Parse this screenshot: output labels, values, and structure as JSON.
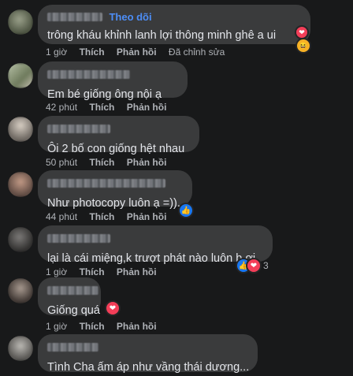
{
  "comments": [
    {
      "follow": "Theo dõi",
      "text": "trông kháu khỉnh lanh lợi thông minh ghê a ui",
      "time": "1 giờ",
      "like": "Thích",
      "reply": "Phản hồi",
      "edited": "Đã chỉnh sửa"
    },
    {
      "text": "Em bé giống ông nội ạ",
      "time": "42 phút",
      "like": "Thích",
      "reply": "Phản hồi"
    },
    {
      "text": "Ôi 2 bố con giống hệt nhau",
      "time": "50 phút",
      "like": "Thích",
      "reply": "Phản hồi"
    },
    {
      "text": "Như photocopy luôn ạ =)).",
      "time": "44 phút",
      "like": "Thích",
      "reply": "Phản hồi"
    },
    {
      "text": "lại là cái miệng,k trượt phát nào luôn b ơi",
      "time": "1 giờ",
      "like": "Thích",
      "reply": "Phản hồi",
      "reaction_count": "3"
    },
    {
      "text": "Giống quá",
      "time": "1 giờ",
      "like": "Thích",
      "reply": "Phản hồi"
    },
    {
      "text": "Tình Cha ấm áp như vầng thái dương..."
    }
  ],
  "colors": {
    "background": "#18191a",
    "bubble": "#3a3b3c",
    "follow": "#4d8ef7",
    "like": "#1877f2",
    "love": "#f33e58"
  },
  "icons": [
    "like-icon",
    "heart-icon",
    "haha-icon"
  ]
}
